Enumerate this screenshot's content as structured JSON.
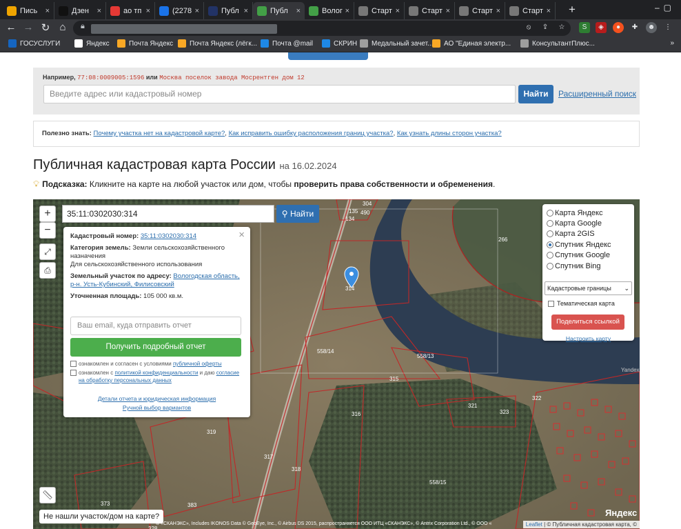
{
  "tabs": [
    {
      "title": "Пись",
      "color": "#f0a500"
    },
    {
      "title": "Дзен",
      "color": "#111111"
    },
    {
      "title": "ао тп",
      "color": "#e53935"
    },
    {
      "title": "(2278",
      "color": "#1a73e8"
    },
    {
      "title": "Публ",
      "color": "#223366"
    },
    {
      "title": "Публ",
      "color": "#43a047",
      "active": true
    },
    {
      "title": "Волог",
      "color": "#43a047"
    },
    {
      "title": "Старт",
      "color": "#777777"
    },
    {
      "title": "Старт",
      "color": "#777777"
    },
    {
      "title": "Старт",
      "color": "#777777"
    },
    {
      "title": "Старт",
      "color": "#777777"
    }
  ],
  "bookmarks": [
    {
      "label": "ГОСУСЛУГИ",
      "color": "#1565c0"
    },
    {
      "label": "Яндекс",
      "color": "#ffffff"
    },
    {
      "label": "Почта Яндекс",
      "color": "#f9a825"
    },
    {
      "label": "Почта Яндекс (лёгк...",
      "color": "#f9a825"
    },
    {
      "label": "Почта @mail",
      "color": "#1e88e5"
    },
    {
      "label": "СКРИН",
      "color": "#1e88e5"
    },
    {
      "label": "Медальный зачет...",
      "color": "#9e9e9e"
    },
    {
      "label": "АО \"Единая электр...",
      "color": "#f9a825"
    },
    {
      "label": "КонсультантПлюс...",
      "color": "#9e9e9e"
    }
  ],
  "search": {
    "example_prefix": "Например,",
    "example_number": "77:08:0009005:1596",
    "example_or": "или",
    "example_address": "Москва поселок завода Мосрентген дом 12",
    "placeholder": "Введите адрес или кадастровый номер",
    "find_label": "Найти",
    "advanced_label": "Расширенный поиск"
  },
  "useful": {
    "prefix": "Полезно знать:",
    "link1": "Почему участка нет на кадастровой карте?",
    "link2": "Как исправить ошибку расположения границ участка?",
    "link3": "Как узнать длины сторон участка?"
  },
  "title": {
    "main": "Публичная кадастровая карта России",
    "date": "на 16.02.2024"
  },
  "hint": {
    "label": "Подсказка:",
    "text": "Кликните на карте на любой участок или дом, чтобы",
    "bold": "проверить права собственности и обременения",
    "end": "."
  },
  "map": {
    "zoom_in": "+",
    "zoom_out": "−",
    "search_value": "35:11:0302030:314",
    "find_label": "Найти",
    "popup": {
      "cad_label": "Кадастровый номер:",
      "cad_value": "35:11:0302030:314",
      "cat_label": "Категория земель:",
      "cat_value": "Земли сельскохозяйственного назначения",
      "use_value": "Для сельскохозяйственного использования",
      "addr_label": "Земельный участок по адресу:",
      "addr_value": "Вологодская область, р-н. Усть-Кубинский, Филисовский",
      "area_label": "Уточненная площадь:",
      "area_value": "105 000 кв.м.",
      "email_placeholder": "Ваш email, куда отправить отчет",
      "report_label": "Получить подробный отчет",
      "chk1_pre": "ознакомлен и согласен с условиями",
      "chk1_link": "публичной оферты",
      "chk2_pre": "ознакомлен с",
      "chk2_link": "политикой конфиденциальности",
      "chk2_mid": "и даю",
      "chk2_link2": "согласие на обработку персональных данных",
      "details_link": "Детали отчета и юридическая информация",
      "manual_link": "Ручной выбор вариантов"
    },
    "layers": {
      "options": [
        "Карта Яндекс",
        "Карта Google",
        "Карта 2GIS",
        "Спутник Яндекс",
        "Спутник Google",
        "Спутник Bing"
      ],
      "selected": "Спутник Яндекс",
      "select_value": "Кадастровые границы",
      "thematic": "Тематическая карта",
      "share": "Поделиться ссылкой",
      "setup": "Настроить карту"
    },
    "not_found": "Не нашли участок/дом на карте?",
    "attribution": "© «СКАНЭКС», Includes IKONOS Data © GeoEye, Inc., © Airbus DS 2015, распространяется ООО ИТЦ «СКАНЭКС», © Antrix Corporation Ltd., © ООО «",
    "leaflet": "Leaflet",
    "leaflet_rest": "| © Публичная кадастровая карта, ©",
    "yandex_logo": "Яндекс",
    "yandex_small": "Yandex",
    "parcel_labels": [
      {
        "t": "304"
      },
      {
        "t": "135"
      },
      {
        "t": "490"
      },
      {
        "t": "134"
      },
      {
        "t": "266"
      },
      {
        "t": "314"
      },
      {
        "t": "558/14"
      },
      {
        "t": "558/13"
      },
      {
        "t": "315"
      },
      {
        "t": "316"
      },
      {
        "t": "322"
      },
      {
        "t": "321"
      },
      {
        "t": "323"
      },
      {
        "t": "319"
      },
      {
        "t": "317"
      },
      {
        "t": "318"
      },
      {
        "t": "558/15"
      },
      {
        "t": "373"
      },
      {
        "t": "383"
      },
      {
        "t": "328"
      }
    ]
  }
}
